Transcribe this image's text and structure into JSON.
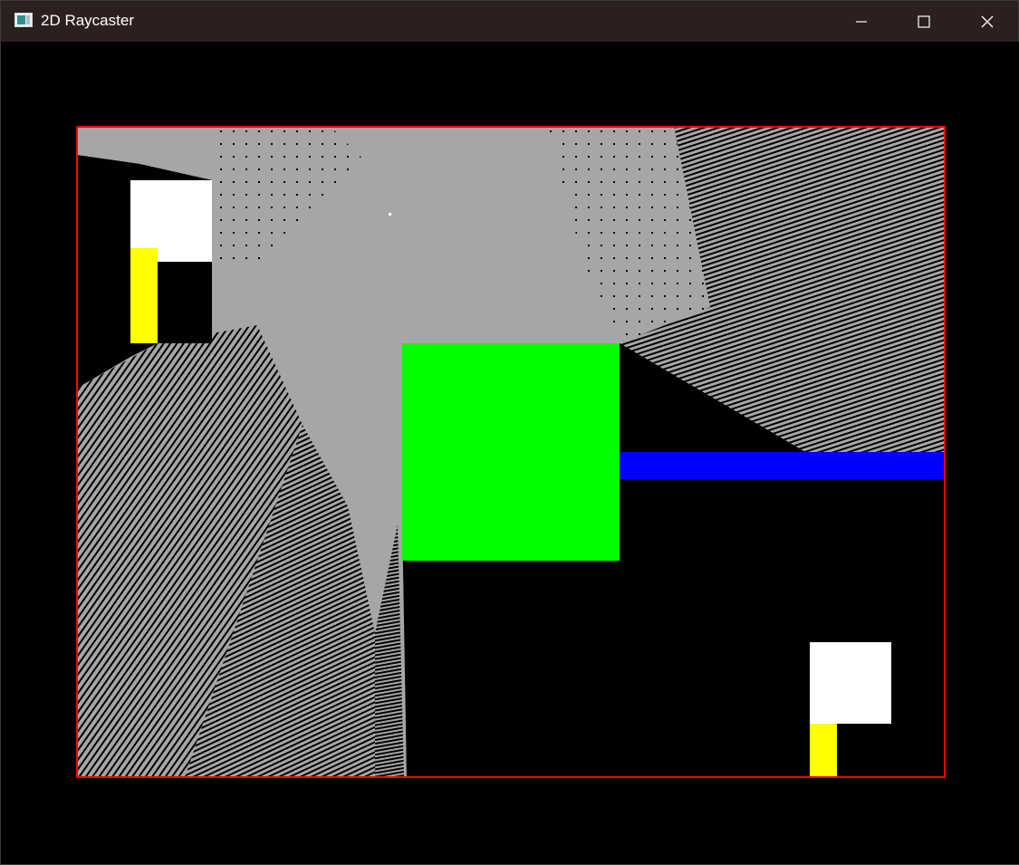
{
  "window": {
    "title": "2D Raycaster",
    "controls": {
      "minimize": "minimize",
      "maximize": "maximize",
      "close": "close"
    }
  },
  "scene": {
    "background": "#000000",
    "light_color": "#a6a6a6",
    "border_color": "#ff0000",
    "objects": [
      {
        "name": "white-block-top",
        "color": "#ffffff"
      },
      {
        "name": "yellow-block-top",
        "color": "#ffff00"
      },
      {
        "name": "green-block",
        "color": "#00ff00"
      },
      {
        "name": "blue-wall",
        "color": "#0000ff"
      },
      {
        "name": "white-block-bottom",
        "color": "#ffffff"
      },
      {
        "name": "yellow-block-bottom",
        "color": "#ffff00"
      }
    ],
    "light_source": {
      "name": "light-source",
      "color": "#ffffff"
    }
  }
}
